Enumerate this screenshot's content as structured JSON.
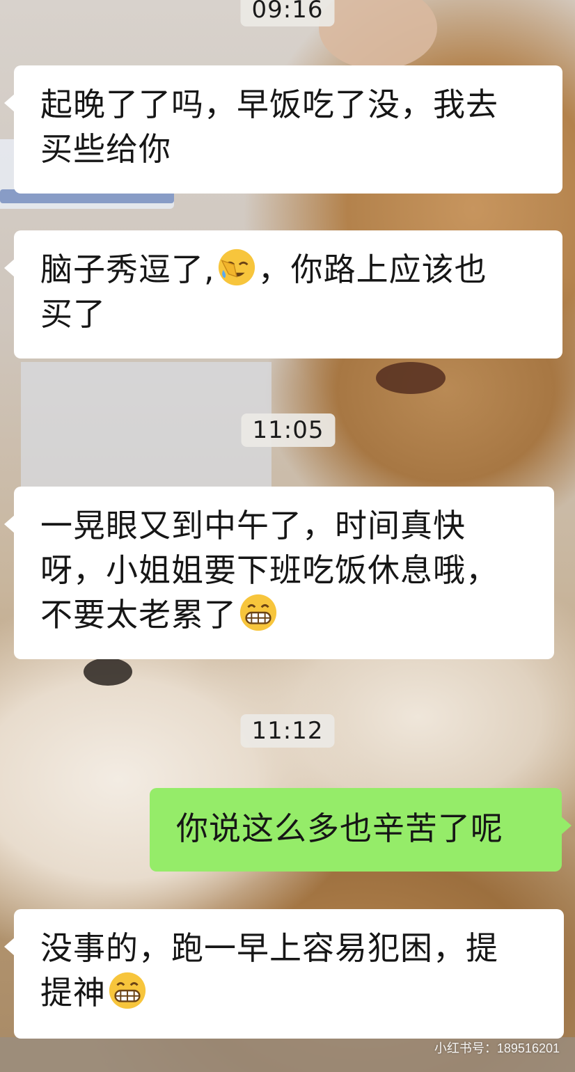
{
  "messages": [
    {
      "type": "time",
      "text": "09:16"
    },
    {
      "type": "received",
      "lines": [
        "起晚了了吗，早饭吃了没，我去",
        "买些给你"
      ]
    },
    {
      "type": "received",
      "lines": [
        "脑子秀逗了,",
        "，你路上应该也",
        "买了"
      ],
      "emoji": "facepalm-crying-emoji"
    },
    {
      "type": "time",
      "text": "11:05"
    },
    {
      "type": "received",
      "lines": [
        "一晃眼又到中午了，时间真快",
        "呀，小姐姐要下班吃饭休息哦，",
        "不要太老累了"
      ],
      "emoji": "grinning-emoji"
    },
    {
      "type": "time",
      "text": "11:12"
    },
    {
      "type": "sent",
      "lines": [
        "你说这么多也辛苦了呢"
      ]
    },
    {
      "type": "received",
      "lines": [
        "没事的，跑一早上容易犯困，提",
        "提神"
      ],
      "emoji": "grinning-emoji"
    }
  ],
  "watermark": "小红书号：189516201",
  "colors": {
    "received_bubble": "#ffffff",
    "sent_bubble": "#95ec69",
    "timestamp_bg": "#ece9e5",
    "text": "#161616"
  }
}
